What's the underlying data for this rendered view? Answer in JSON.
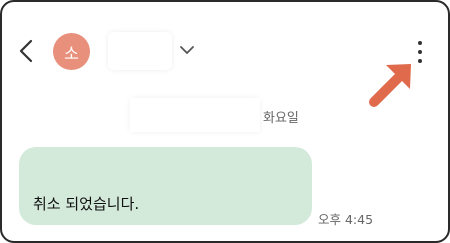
{
  "header": {
    "contact_initial": "소",
    "back_icon": "back-arrow-icon",
    "more_icon": "more-vert-icon",
    "dropdown_icon": "chevron-down-icon",
    "avatar_color": "#e8907c",
    "annotation_arrow_color": "#e06a4c"
  },
  "conversation": {
    "date_label": "화요일",
    "messages": [
      {
        "text": "취소 되었습니다.",
        "time": "오후 4:45",
        "bubble_color": "#d3eadb"
      }
    ]
  }
}
